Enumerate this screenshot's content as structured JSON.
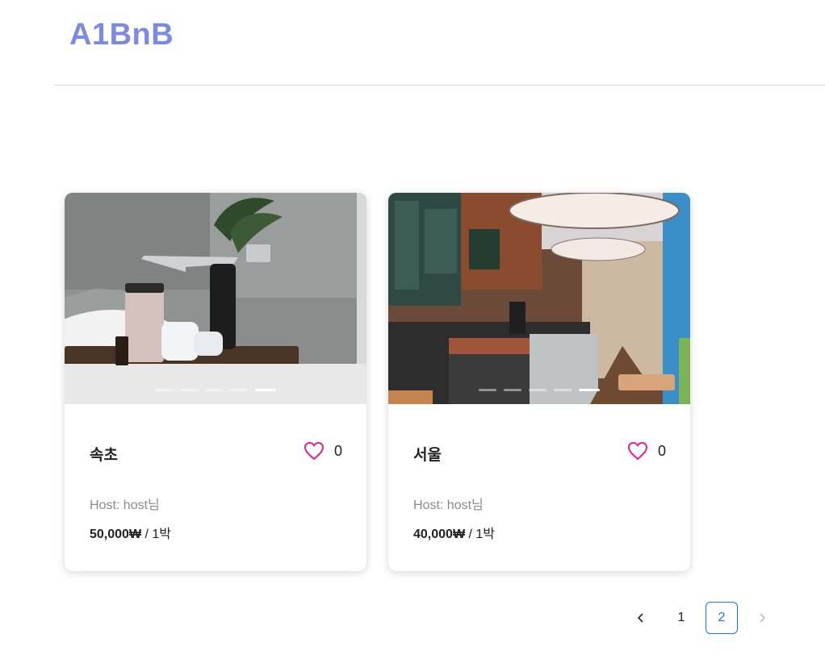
{
  "app": {
    "logo": "A1BnB"
  },
  "listings": [
    {
      "title": "속초",
      "like_count": "0",
      "host": "Host: host님",
      "price_amount": "50,000₩",
      "price_unit": " / 1박",
      "photo_icon": "bathroom-photo",
      "slides": 5,
      "active_slide": 5
    },
    {
      "title": "서울",
      "like_count": "0",
      "host": "Host: host님",
      "price_amount": "40,000₩",
      "price_unit": " / 1박",
      "photo_icon": "cafe-photo",
      "slides": 5,
      "active_slide": 5
    }
  ],
  "pagination": {
    "prev_icon": "chevron-left-icon",
    "next_icon": "chevron-right-icon",
    "pages": [
      "1",
      "2"
    ],
    "current_page": "2"
  },
  "colors": {
    "logo": "#7b8ae4",
    "heart": "#e91e8c",
    "pagination_active": "#1677ff"
  }
}
